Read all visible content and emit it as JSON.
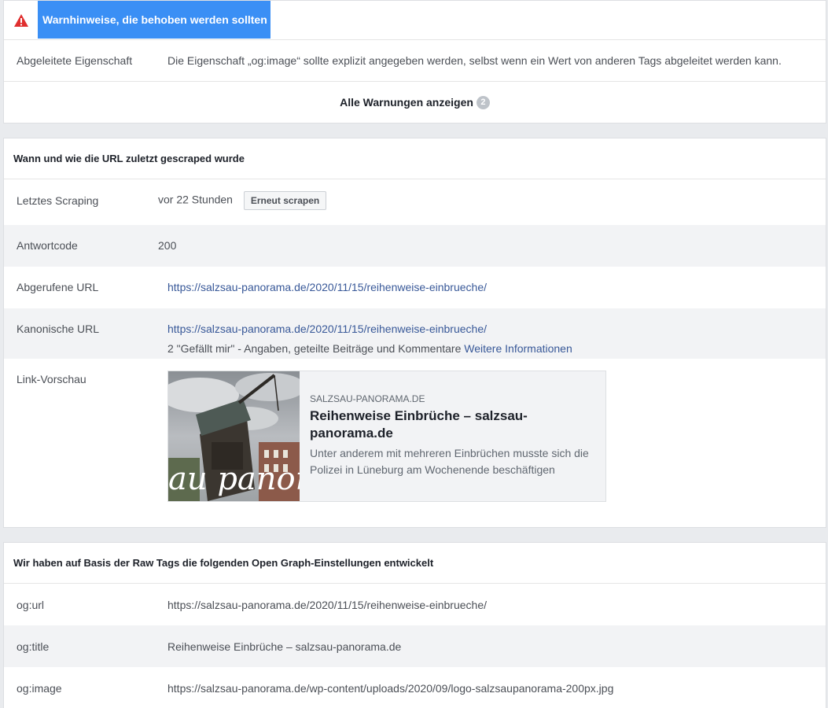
{
  "warnings": {
    "header": "Warnhinweise, die behoben werden sollten",
    "rows": [
      {
        "key": "Abgeleitete Eigenschaft",
        "value": "Die Eigenschaft „og:image“ sollte explizit angegeben werden, selbst wenn ein Wert von anderen Tags abgeleitet werden kann."
      }
    ],
    "show_all_label": "Alle Warnungen anzeigen",
    "count": "2",
    "icon": "warning-triangle-icon",
    "icon_color": "#e02f2f",
    "highlight_color": "#3a8ff5"
  },
  "scrape": {
    "title": "Wann und wie die URL zuletzt gescraped wurde",
    "last_scrape": {
      "key": "Letztes Scraping",
      "value": "vor 22 Stunden",
      "button": "Erneut scrapen"
    },
    "response_code": {
      "key": "Antwortcode",
      "value": "200"
    },
    "fetched_url": {
      "key": "Abgerufene URL",
      "value": "https://salzsau-panorama.de/2020/11/15/reihenweise-einbrueche/"
    },
    "canonical_url": {
      "key": "Kanonische URL",
      "value": "https://salzsau-panorama.de/2020/11/15/reihenweise-einbrueche/",
      "likes_text": "2 \"Gefällt mir\" - Angaben, geteilte Beiträge und Kommentare",
      "more_link": "Weitere Informationen"
    },
    "preview": {
      "key": "Link-Vorschau",
      "domain": "SALZSAU-PANORAMA.DE",
      "title": "Reihenweise Einbrüche – salzsau-panorama.de",
      "description": "Unter anderem mit mehreren Einbrüchen musste sich die Polizei in Lüneburg am Wochenende beschäftigen",
      "image_overlay_text": "au panor"
    }
  },
  "og": {
    "title": "Wir haben auf Basis der Raw Tags die folgenden Open Graph-Einstellungen entwickelt",
    "rows": [
      {
        "key": "og:url",
        "value": "https://salzsau-panorama.de/2020/11/15/reihenweise-einbrueche/"
      },
      {
        "key": "og:title",
        "value": "Reihenweise Einbrüche – salzsau-panorama.de"
      },
      {
        "key": "og:image",
        "value": "https://salzsau-panorama.de/wp-content/uploads/2020/09/logo-salzsaupanorama-200px.jpg"
      }
    ]
  },
  "colors": {
    "link": "#385898",
    "alt_row": "#f2f3f5",
    "page_bg": "#e9ebee"
  }
}
